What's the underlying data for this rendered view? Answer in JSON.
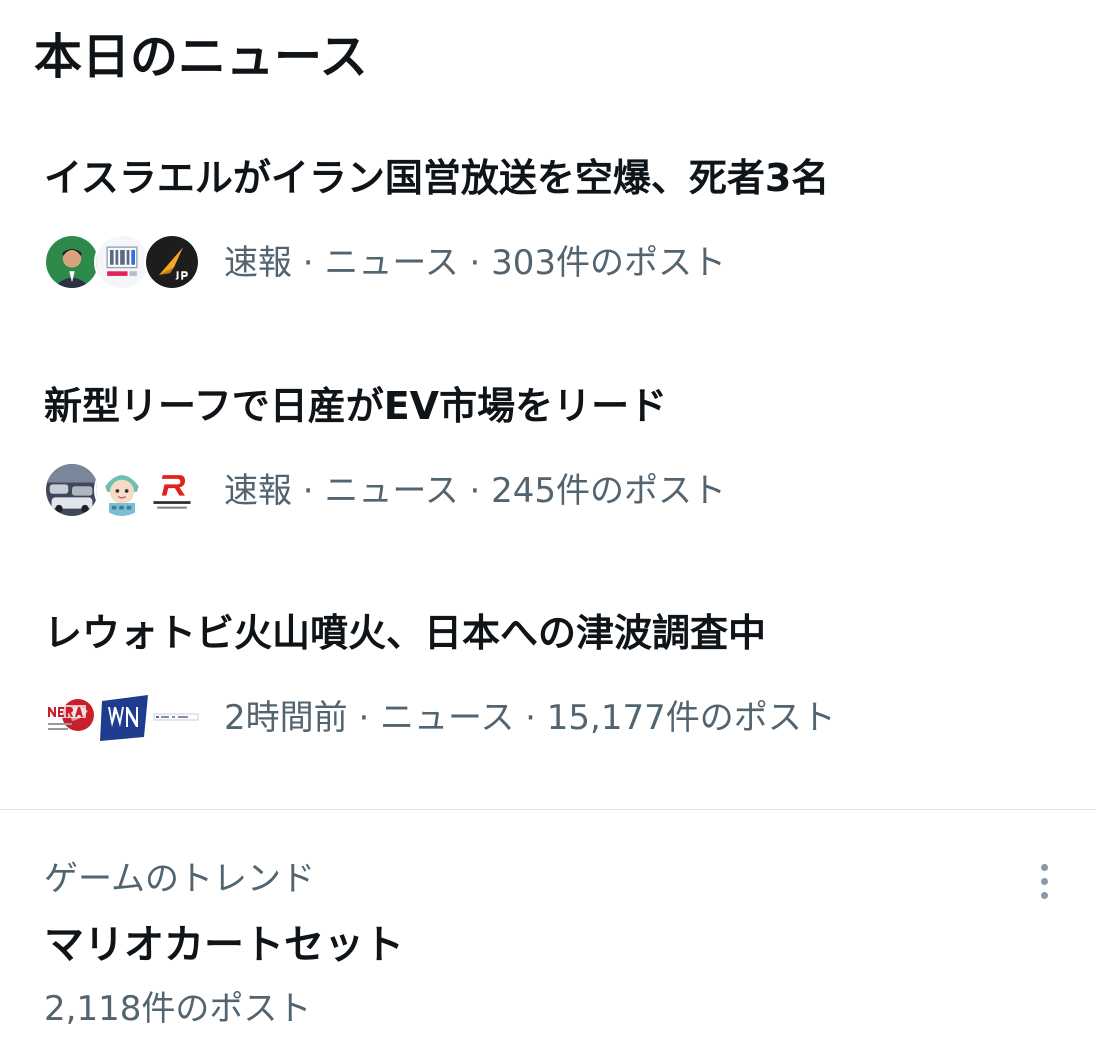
{
  "section": {
    "title": "本日のニュース"
  },
  "news": [
    {
      "headline": "イスラエルがイラン国営放送を空爆、死者3名",
      "meta": "速報 · ニュース · 303件のポスト",
      "avatars": [
        "person-avatar",
        "yahoo-news-avatar",
        "jp-news-avatar"
      ]
    },
    {
      "headline": "新型リーフで日産がEV市場をリード",
      "meta": "速報 · ニュース · 245件のポスト",
      "avatars": [
        "car-event-avatar",
        "cartoon-avatar",
        "response-jp-avatar"
      ]
    },
    {
      "headline": "レウォトビ火山噴火、日本への津波調査中",
      "meta": "2時間前 · ニュース · 15,177件のポスト",
      "avatars": [
        "nera-avatar",
        "wn-avatar",
        "newspaper-avatar"
      ]
    }
  ],
  "trend": {
    "category": "ゲームのトレンド",
    "title": "マリオカートセット",
    "posts": "2,118件のポスト",
    "more_icon": "more-vertical-icon"
  },
  "colors": {
    "text": "#0f1419",
    "secondary": "#536471",
    "divider": "#e3e6e8"
  }
}
